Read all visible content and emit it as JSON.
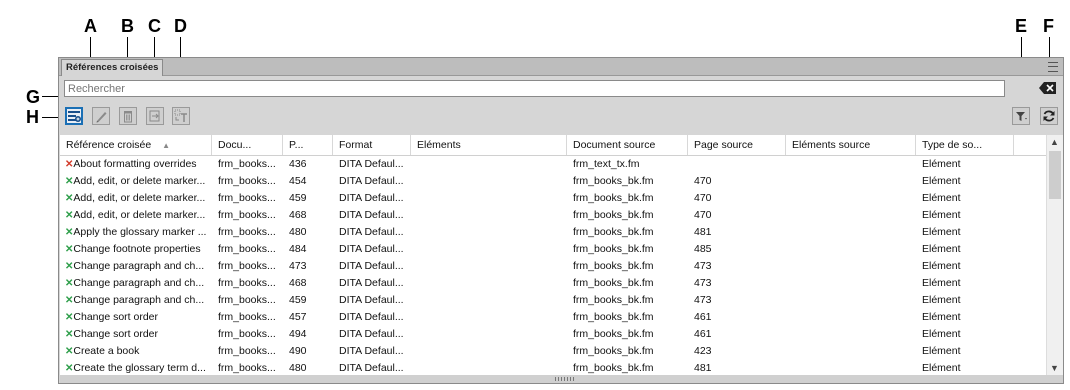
{
  "callouts": [
    "A",
    "B",
    "C",
    "D",
    "E",
    "F",
    "G",
    "H"
  ],
  "panel": {
    "tab_label": "Références croisées",
    "search_placeholder": "Rechercher"
  },
  "toolbar": {
    "buttons": [
      {
        "name": "add-crossref",
        "icon": "add-crossref-icon"
      },
      {
        "name": "edit",
        "icon": "pencil-icon"
      },
      {
        "name": "delete",
        "icon": "trash-icon"
      },
      {
        "name": "insert-source",
        "icon": "insert-icon"
      },
      {
        "name": "convert-text",
        "icon": "convert-text-icon"
      },
      {
        "name": "filter",
        "icon": "filter-icon"
      },
      {
        "name": "refresh",
        "icon": "refresh-icon"
      }
    ]
  },
  "table": {
    "columns": [
      "Référence croisée",
      "Docu...",
      "P...",
      "Format",
      "Eléments",
      "Document source",
      "Page source",
      "Eléments source",
      "Type de so..."
    ],
    "sort_indicator": "▲",
    "rows": [
      {
        "status": "✕",
        "status_color": "#d23b2a",
        "cells": [
          "About formatting overrides",
          "frm_books...",
          "436",
          "DITA Defaul...",
          "",
          "frm_text_tx.fm",
          "",
          "",
          "Elément"
        ]
      },
      {
        "status": "✕",
        "status_color": "#2e9e4a",
        "cells": [
          "Add, edit, or delete marker...",
          "frm_books...",
          "454",
          "DITA Defaul...",
          "",
          "frm_books_bk.fm",
          "470",
          "",
          "Elément"
        ]
      },
      {
        "status": "✕",
        "status_color": "#2e9e4a",
        "cells": [
          "Add, edit, or delete marker...",
          "frm_books...",
          "459",
          "DITA Defaul...",
          "",
          "frm_books_bk.fm",
          "470",
          "",
          "Elément"
        ]
      },
      {
        "status": "✕",
        "status_color": "#2e9e4a",
        "cells": [
          "Add, edit, or delete marker...",
          "frm_books...",
          "468",
          "DITA Defaul...",
          "",
          "frm_books_bk.fm",
          "470",
          "",
          "Elément"
        ]
      },
      {
        "status": "✕",
        "status_color": "#2e9e4a",
        "cells": [
          "Apply the glossary marker ...",
          "frm_books...",
          "480",
          "DITA Defaul...",
          "",
          "frm_books_bk.fm",
          "481",
          "",
          "Elément"
        ]
      },
      {
        "status": "✕",
        "status_color": "#2e9e4a",
        "cells": [
          "Change footnote properties",
          "frm_books...",
          "484",
          "DITA Defaul...",
          "",
          "frm_books_bk.fm",
          "485",
          "",
          "Elément"
        ]
      },
      {
        "status": "✕",
        "status_color": "#2e9e4a",
        "cells": [
          "Change paragraph and ch...",
          "frm_books...",
          "473",
          "DITA Defaul...",
          "",
          "frm_books_bk.fm",
          "473",
          "",
          "Elément"
        ]
      },
      {
        "status": "✕",
        "status_color": "#2e9e4a",
        "cells": [
          "Change paragraph and ch...",
          "frm_books...",
          "468",
          "DITA Defaul...",
          "",
          "frm_books_bk.fm",
          "473",
          "",
          "Elément"
        ]
      },
      {
        "status": "✕",
        "status_color": "#2e9e4a",
        "cells": [
          "Change paragraph and ch...",
          "frm_books...",
          "459",
          "DITA Defaul...",
          "",
          "frm_books_bk.fm",
          "473",
          "",
          "Elément"
        ]
      },
      {
        "status": "✕",
        "status_color": "#2e9e4a",
        "cells": [
          "Change sort order",
          "frm_books...",
          "457",
          "DITA Defaul...",
          "",
          "frm_books_bk.fm",
          "461",
          "",
          "Elément"
        ]
      },
      {
        "status": "✕",
        "status_color": "#2e9e4a",
        "cells": [
          "Change sort order",
          "frm_books...",
          "494",
          "DITA Defaul...",
          "",
          "frm_books_bk.fm",
          "461",
          "",
          "Elément"
        ]
      },
      {
        "status": "✕",
        "status_color": "#2e9e4a",
        "cells": [
          "Create a book",
          "frm_books...",
          "490",
          "DITA Defaul...",
          "",
          "frm_books_bk.fm",
          "423",
          "",
          "Elément"
        ]
      },
      {
        "status": "✕",
        "status_color": "#2e9e4a",
        "cells": [
          "Create the glossary term d...",
          "frm_books...",
          "480",
          "DITA Defaul...",
          "",
          "frm_books_bk.fm",
          "481",
          "",
          "Elément"
        ]
      }
    ]
  }
}
